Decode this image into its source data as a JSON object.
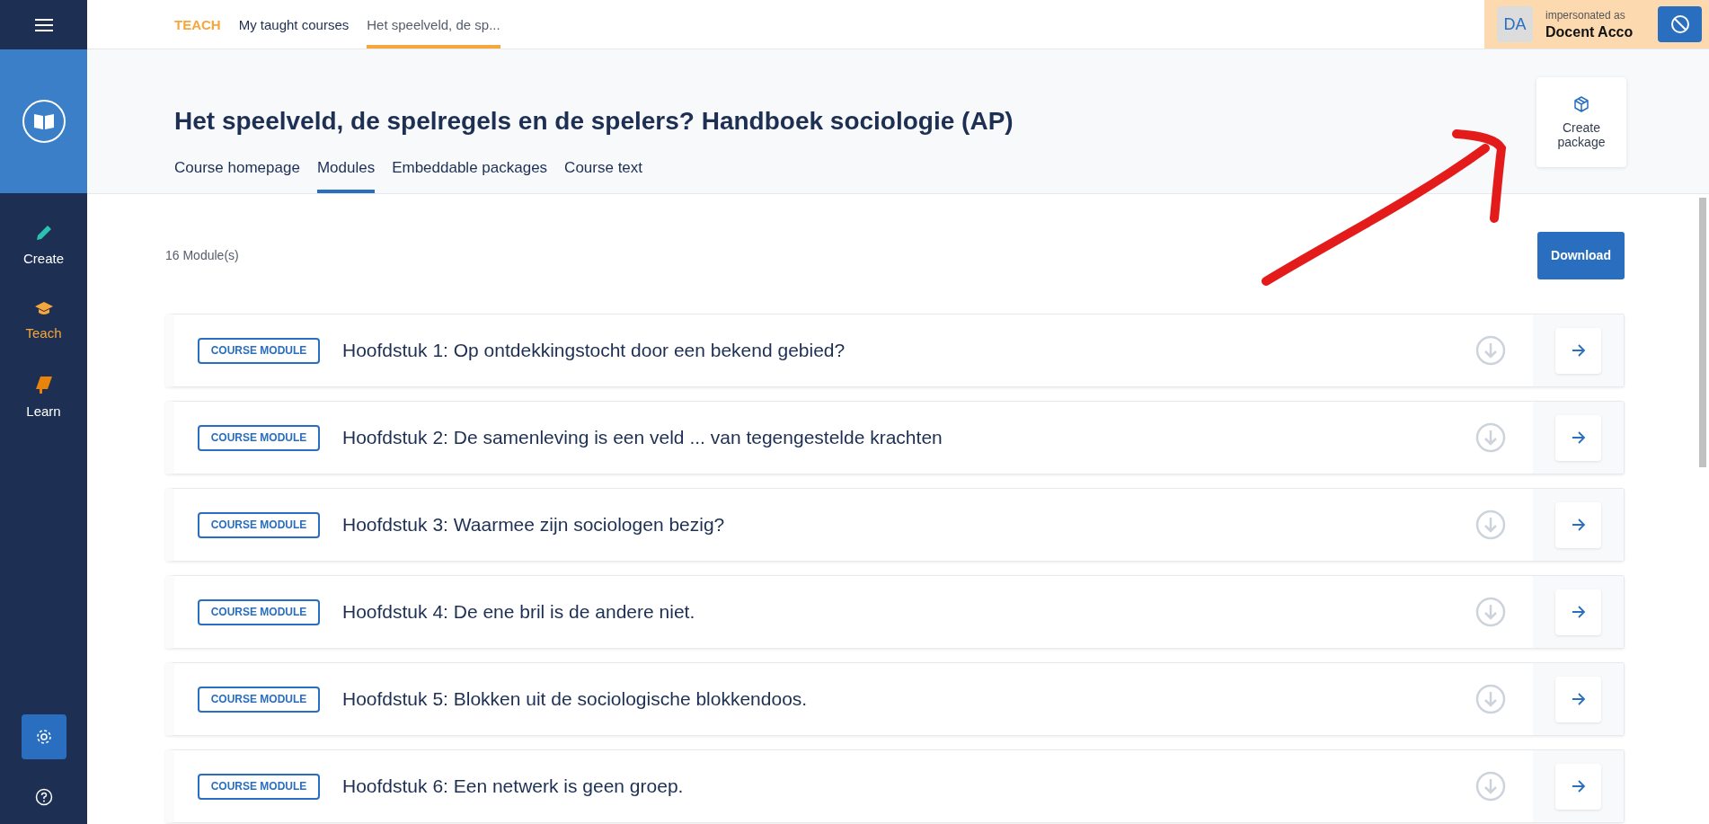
{
  "sidebar": {
    "items": [
      {
        "kind": "create",
        "label": "Create",
        "selected": false
      },
      {
        "kind": "teach",
        "label": "Teach",
        "selected": true
      },
      {
        "kind": "learn",
        "label": "Learn",
        "selected": false
      }
    ]
  },
  "breadcrumb": [
    {
      "label": "TEACH",
      "selected": false,
      "kind": "section"
    },
    {
      "label": "My taught courses",
      "selected": false,
      "kind": "link"
    },
    {
      "label": "Het speelveld, de sp...",
      "selected": true,
      "kind": "link"
    }
  ],
  "impersonation": {
    "initials": "DA",
    "caption": "impersonated as",
    "name": "Docent Acco"
  },
  "course": {
    "title": "Het speelveld, de spelregels en de spelers? Handboek sociologie (AP)"
  },
  "tabs": [
    {
      "label": "Course homepage",
      "selected": false
    },
    {
      "label": "Modules",
      "selected": true
    },
    {
      "label": "Embeddable packages",
      "selected": false
    },
    {
      "label": "Course text",
      "selected": false
    }
  ],
  "create_package": {
    "label": "Create package"
  },
  "module_count": "16 Module(s)",
  "download_button": "Download",
  "modules": [
    {
      "tag": "COURSE MODULE",
      "title": "Hoofdstuk 1: Op ontdekkingstocht door een bekend gebied?"
    },
    {
      "tag": "COURSE MODULE",
      "title": "Hoofdstuk 2: De samenleving is een veld ... van tegengestelde krachten"
    },
    {
      "tag": "COURSE MODULE",
      "title": "Hoofdstuk 3: Waarmee zijn sociologen bezig?"
    },
    {
      "tag": "COURSE MODULE",
      "title": "Hoofdstuk 4: De ene bril is de andere niet."
    },
    {
      "tag": "COURSE MODULE",
      "title": "Hoofdstuk 5: Blokken uit de sociologische blokkendoos."
    },
    {
      "tag": "COURSE MODULE",
      "title": "Hoofdstuk 6: Een netwerk is geen groep."
    }
  ]
}
